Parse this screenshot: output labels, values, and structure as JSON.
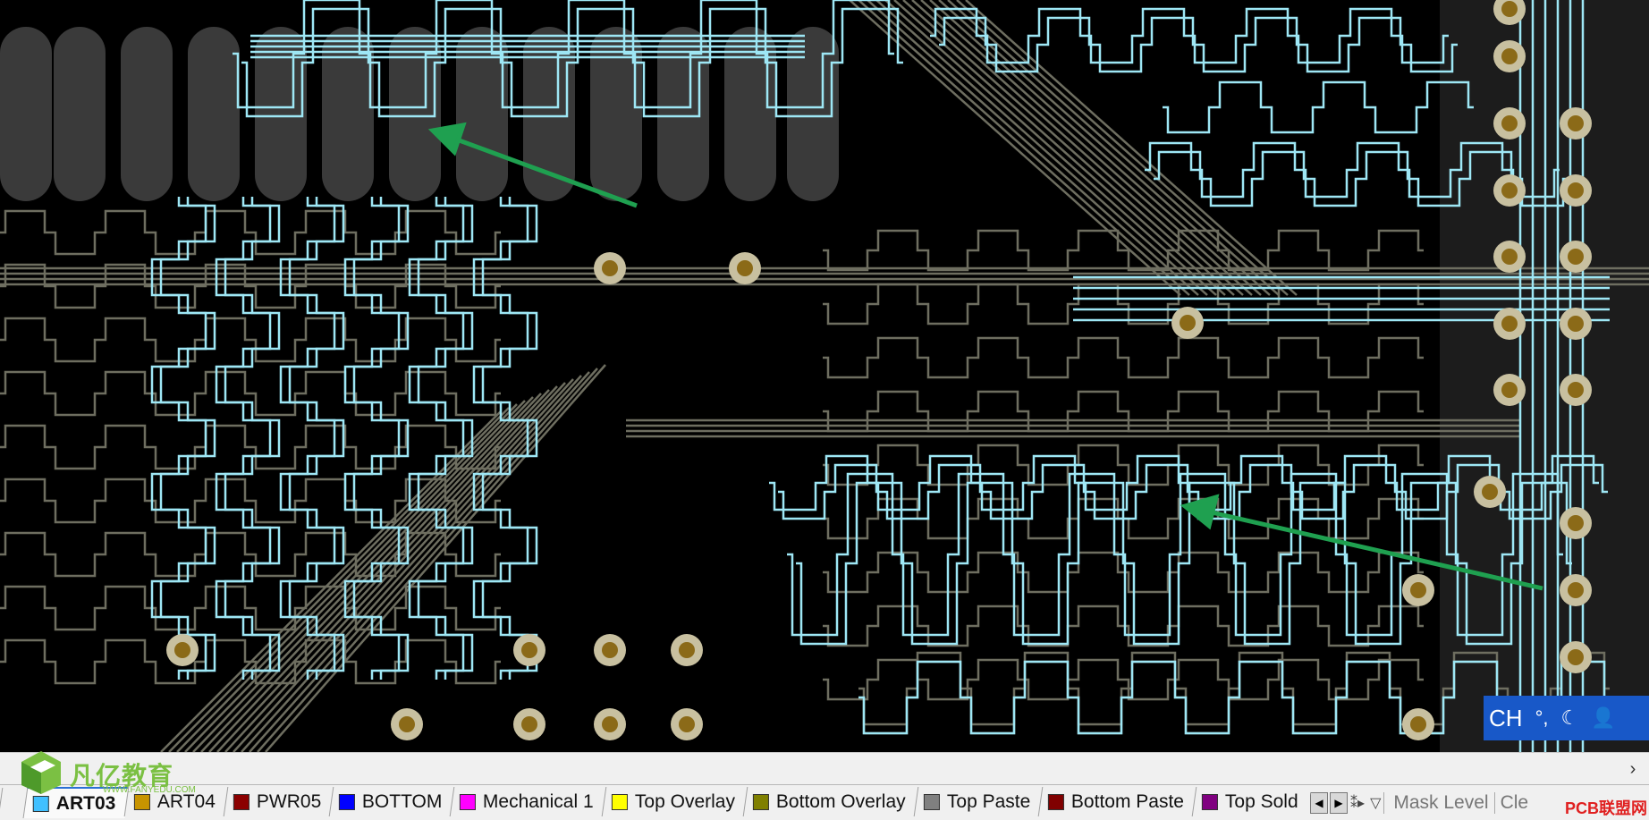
{
  "ime": {
    "lang": "CH",
    "punct": "°,",
    "moon": "☾",
    "user": "👤"
  },
  "logo": {
    "cn": "凡亿教育",
    "en": "WWW.FANYEDU.COM"
  },
  "layer_tabs": [
    {
      "label": "ART03",
      "color": "#40c0ff",
      "active": true
    },
    {
      "label": "ART04",
      "color": "#c89400"
    },
    {
      "label": "PWR05",
      "color": "#8b0000"
    },
    {
      "label": "BOTTOM",
      "color": "#0000ff"
    },
    {
      "label": "Mechanical 1",
      "color": "#ff00ff"
    },
    {
      "label": "Top Overlay",
      "color": "#ffff00"
    },
    {
      "label": "Bottom Overlay",
      "color": "#808000"
    },
    {
      "label": "Top Paste",
      "color": "#808080"
    },
    {
      "label": "Bottom Paste",
      "color": "#800000"
    },
    {
      "label": "Top Sold",
      "color": "#800080"
    }
  ],
  "mask_level": "Mask Level",
  "clear": "Cle",
  "watermark": "PCB联盟网",
  "colors": {
    "trace_active": "#9ee7f5",
    "trace_inactive": "#6e6e60",
    "pad": "#c8c0a0",
    "pad_hole": "#8b6a18",
    "arrow": "#1fa050"
  }
}
